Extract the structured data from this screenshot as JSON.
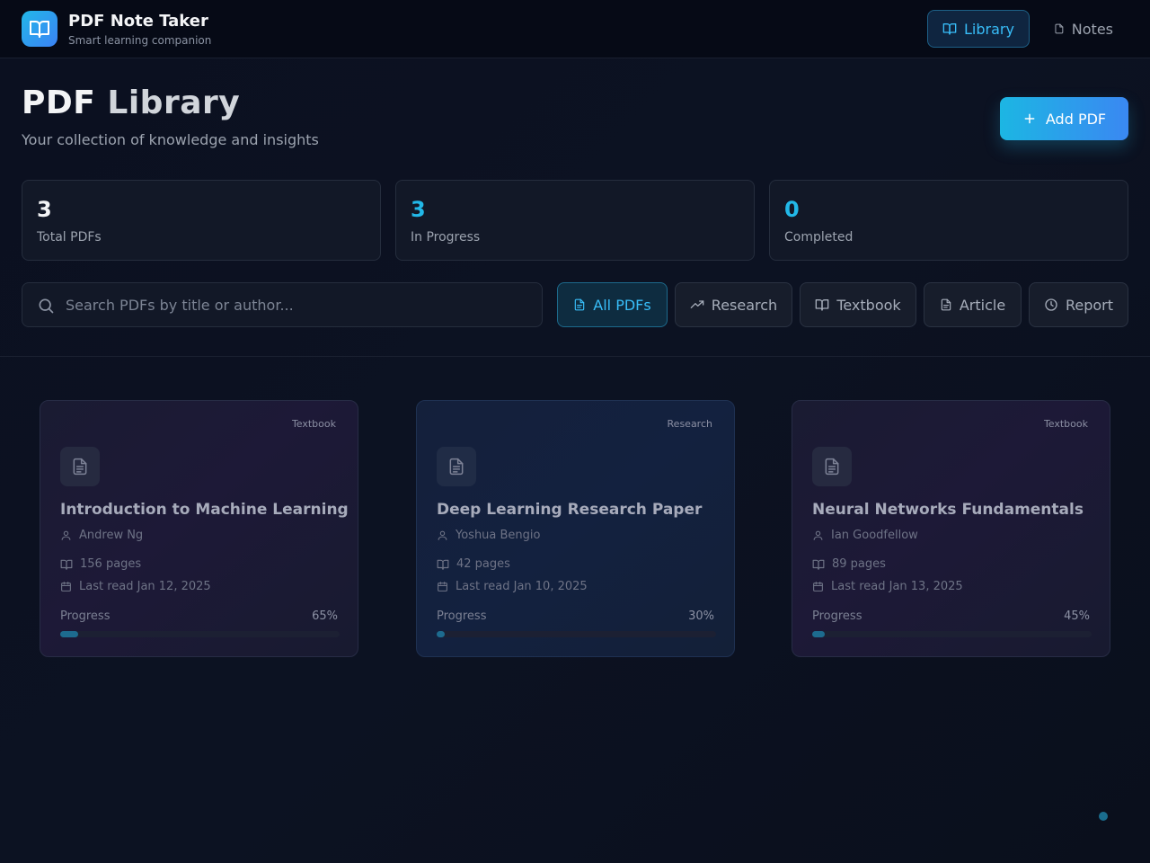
{
  "app": {
    "title": "PDF Note Taker",
    "subtitle": "Smart learning companion",
    "logo_icon": "open-book-icon",
    "accent": "#22b8e8"
  },
  "nav": {
    "library_label": "Library",
    "notes_label": "Notes",
    "active": "Library"
  },
  "header": {
    "title_part1": "PDF",
    "title_part2": "Library",
    "subtitle": "Your collection of knowledge and insights",
    "add_button": "Add PDF"
  },
  "stats": [
    {
      "value": "3",
      "label": "Total PDFs",
      "color": "#f3f4f6"
    },
    {
      "value": "3",
      "label": "In Progress",
      "color": "#22b8e8"
    },
    {
      "value": "0",
      "label": "Completed",
      "color": "#22b8e8"
    }
  ],
  "search": {
    "placeholder": "Search PDFs by title or author...",
    "value": ""
  },
  "filters": [
    {
      "label": "All PDFs",
      "icon": "file-icon",
      "active": true
    },
    {
      "label": "Research",
      "icon": "trending-up-icon",
      "active": false
    },
    {
      "label": "Textbook",
      "icon": "book-open-icon",
      "active": false
    },
    {
      "label": "Article",
      "icon": "file-text-icon",
      "active": false
    },
    {
      "label": "Report",
      "icon": "clock-icon",
      "active": false
    }
  ],
  "pdfs": [
    {
      "type": "Textbook",
      "title": "Introduction to Machine Learning",
      "author": "Andrew Ng",
      "pages": "156 pages",
      "last_read": "Last read Jan 12, 2025",
      "progress_label": "Progress",
      "progress_text": "65%",
      "progress": 0.065
    },
    {
      "type": "Research",
      "title": "Deep Learning Research Paper",
      "author": "Yoshua Bengio",
      "pages": "42 pages",
      "last_read": "Last read Jan 10, 2025",
      "progress_label": "Progress",
      "progress_text": "30%",
      "progress": 0.03
    },
    {
      "type": "Textbook",
      "title": "Neural Networks Fundamentals",
      "author": "Ian Goodfellow",
      "pages": "89 pages",
      "last_read": "Last read Jan 13, 2025",
      "progress_label": "Progress",
      "progress_text": "45%",
      "progress": 0.045
    }
  ]
}
